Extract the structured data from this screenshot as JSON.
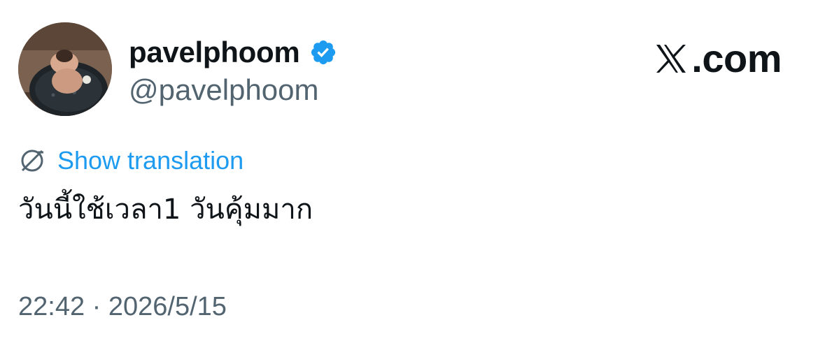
{
  "user": {
    "display_name": "pavelphoom",
    "handle": "@pavelphoom",
    "verified": true,
    "avatar_icon": "profile-photo"
  },
  "brand": {
    "text": ".com",
    "logo_icon": "x-logo-icon"
  },
  "tweet": {
    "translate_label": "Show translation",
    "translate_icon": "globe-translate-icon",
    "text": "วันนี้ใช้เวลา1 วันคุ้มมาก",
    "timestamp": "22:42 · 2026/5/15"
  },
  "colors": {
    "text_primary": "#0f1419",
    "text_secondary": "#536471",
    "link_blue": "#1d9bf0",
    "verified_blue": "#1d9bf0"
  }
}
